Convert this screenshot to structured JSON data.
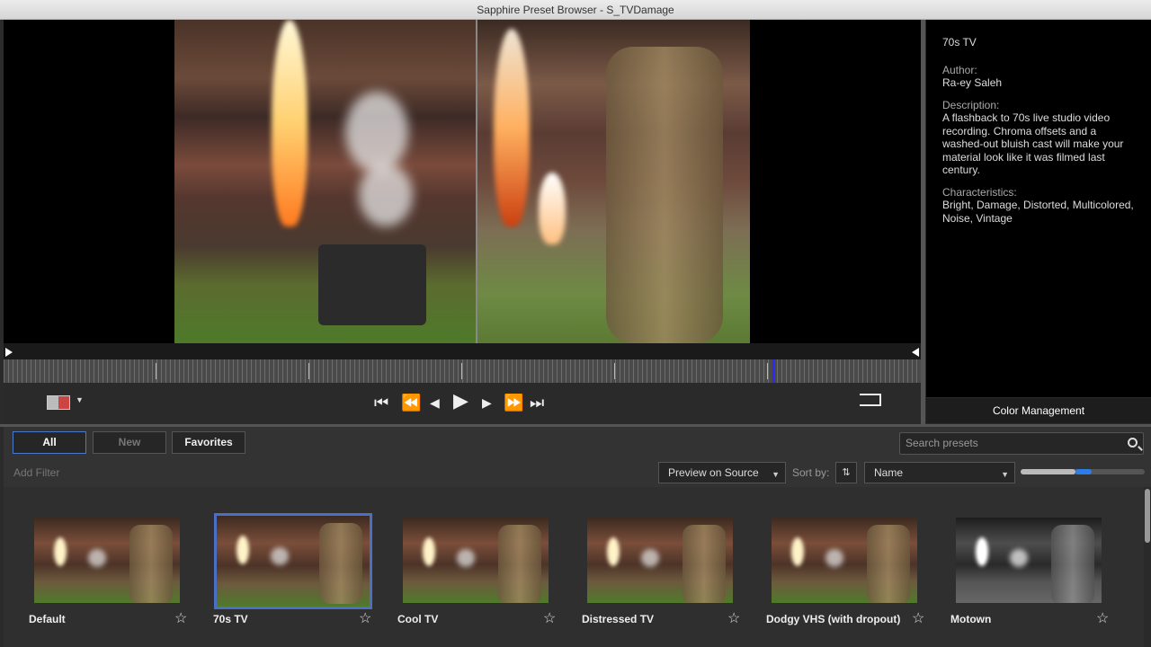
{
  "window": {
    "title": "Sapphire Preset Browser - S_TVDamage"
  },
  "info": {
    "preset_name": "70s TV",
    "author_label": "Author:",
    "author": "Ra-ey Saleh",
    "description_label": "Description:",
    "description": "A flashback to 70s live studio video recording.  Chroma offsets and a washed-out bluish cast will make your material look like it was filmed last century.",
    "characteristics_label": "Characteristics:",
    "characteristics": "Bright, Damage, Distorted, Multicolored, Noise, Vintage",
    "color_management": "Color Management"
  },
  "transport": {
    "icons": [
      "go-to-start-icon",
      "step-back-icon",
      "frame-back-icon",
      "play-icon",
      "frame-forward-icon",
      "step-forward-icon",
      "go-to-end-icon",
      "loop-icon",
      "compare-split-icon"
    ],
    "playhead_fraction": 0.838
  },
  "filters": {
    "all": "All",
    "new": "New",
    "favorites": "Favorites",
    "add_filter": "Add Filter"
  },
  "search": {
    "placeholder": "Search presets"
  },
  "toolbar": {
    "preview_mode": "Preview on Source",
    "sort_label": "Sort by:",
    "sort_value": "Name",
    "thumb_size_fraction": 0.44
  },
  "presets": [
    {
      "name": "Default",
      "selected": false
    },
    {
      "name": "70s TV",
      "selected": true
    },
    {
      "name": "Cool TV",
      "selected": false
    },
    {
      "name": "Distressed TV",
      "selected": false
    },
    {
      "name": "Dodgy VHS (with dropout)",
      "selected": false
    },
    {
      "name": "Motown",
      "selected": false
    }
  ],
  "colors": {
    "accent": "#2c7de8",
    "selection": "#4b6fc6",
    "playhead": "#2a2aff"
  }
}
